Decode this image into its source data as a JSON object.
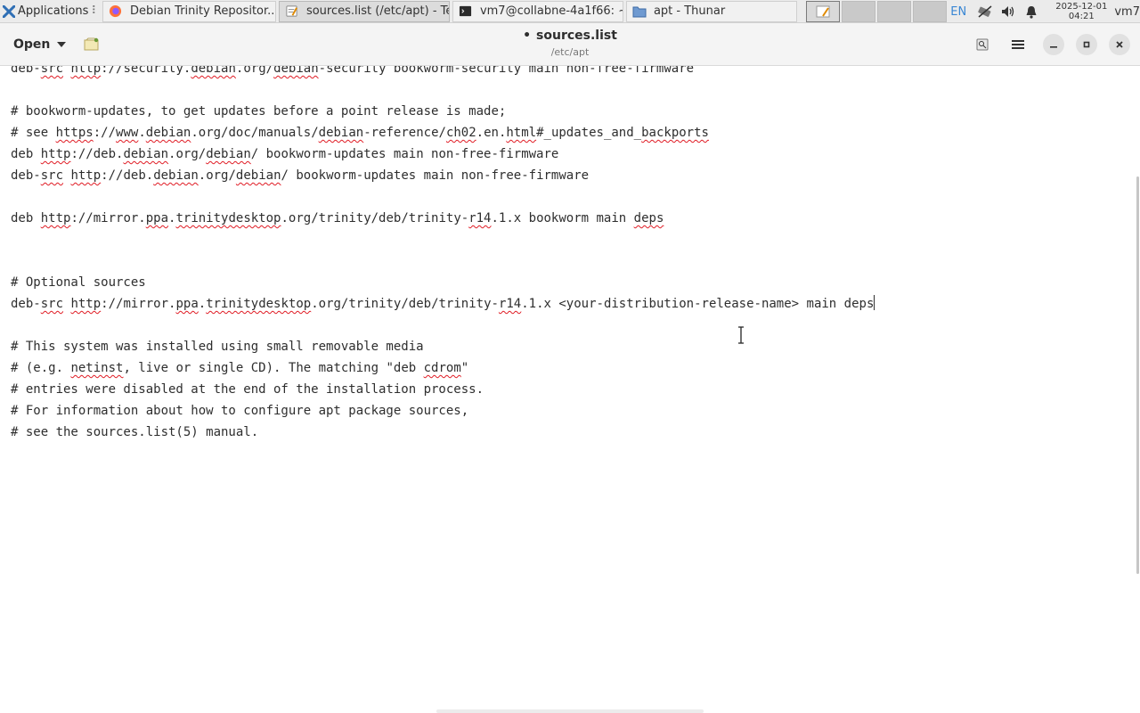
{
  "panel": {
    "applications_label": "Applications",
    "tasks": [
      {
        "label": "Debian Trinity Repositor...",
        "icon": "firefox-icon"
      },
      {
        "label": "sources.list (/etc/apt) - Te...",
        "icon": "text-editor-icon"
      },
      {
        "label": "vm7@collabne-4a1f66: ~",
        "icon": "terminal-icon"
      },
      {
        "label": "apt - Thunar",
        "icon": "folder-icon"
      }
    ],
    "keyboard_layout": "EN",
    "date": "2025-12-01",
    "time": "04:21",
    "user": "vm7"
  },
  "header": {
    "open_label": "Open",
    "title": "sources.list",
    "modified_marker": "•",
    "subtitle": "/etc/apt"
  },
  "editor": {
    "lines": [
      [
        {
          "t": "deb-"
        },
        {
          "t": "src",
          "s": 1
        },
        {
          "t": " "
        },
        {
          "t": "http",
          "s": 1
        },
        {
          "t": "://security."
        },
        {
          "t": "debian",
          "s": 1
        },
        {
          "t": ".org/"
        },
        {
          "t": "debian",
          "s": 1
        },
        {
          "t": "-security bookworm-security main non-free-firmware"
        }
      ],
      [],
      [
        {
          "t": "# bookworm-updates, to get updates before a point release is made;"
        }
      ],
      [
        {
          "t": "# see "
        },
        {
          "t": "https",
          "s": 1
        },
        {
          "t": "://"
        },
        {
          "t": "www",
          "s": 1
        },
        {
          "t": "."
        },
        {
          "t": "debian",
          "s": 1
        },
        {
          "t": ".org/doc/manuals/"
        },
        {
          "t": "debian",
          "s": 1
        },
        {
          "t": "-reference/"
        },
        {
          "t": "ch02",
          "s": 1
        },
        {
          "t": ".en."
        },
        {
          "t": "html",
          "s": 1
        },
        {
          "t": "#_updates_and_"
        },
        {
          "t": "backports",
          "s": 1
        }
      ],
      [
        {
          "t": "deb "
        },
        {
          "t": "http",
          "s": 1
        },
        {
          "t": "://deb."
        },
        {
          "t": "debian",
          "s": 1
        },
        {
          "t": ".org/"
        },
        {
          "t": "debian",
          "s": 1
        },
        {
          "t": "/ bookworm-updates main non-free-firmware"
        }
      ],
      [
        {
          "t": "deb-"
        },
        {
          "t": "src",
          "s": 1
        },
        {
          "t": " "
        },
        {
          "t": "http",
          "s": 1
        },
        {
          "t": "://deb."
        },
        {
          "t": "debian",
          "s": 1
        },
        {
          "t": ".org/"
        },
        {
          "t": "debian",
          "s": 1
        },
        {
          "t": "/ bookworm-updates main non-free-firmware"
        }
      ],
      [],
      [
        {
          "t": "deb "
        },
        {
          "t": "http",
          "s": 1
        },
        {
          "t": "://mirror."
        },
        {
          "t": "ppa",
          "s": 1
        },
        {
          "t": "."
        },
        {
          "t": "trinitydesktop",
          "s": 1
        },
        {
          "t": ".org/trinity/deb/trinity-"
        },
        {
          "t": "r14",
          "s": 1
        },
        {
          "t": ".1.x bookworm main "
        },
        {
          "t": "deps",
          "s": 1
        }
      ],
      [],
      [],
      [
        {
          "t": "# Optional sources"
        }
      ],
      [
        {
          "t": "deb-"
        },
        {
          "t": "src",
          "s": 1
        },
        {
          "t": " "
        },
        {
          "t": "http",
          "s": 1
        },
        {
          "t": "://mirror."
        },
        {
          "t": "ppa",
          "s": 1
        },
        {
          "t": "."
        },
        {
          "t": "trinitydesktop",
          "s": 1
        },
        {
          "t": ".org/trinity/deb/trinity-"
        },
        {
          "t": "r14",
          "s": 1
        },
        {
          "t": ".1.x <your-distribution-release-name> main deps"
        },
        {
          "cursor": 1
        }
      ],
      [],
      [
        {
          "t": "# This system was installed using small removable media"
        }
      ],
      [
        {
          "t": "# (e.g. "
        },
        {
          "t": "netinst",
          "s": 1
        },
        {
          "t": ", live or single CD). The matching \"deb "
        },
        {
          "t": "cdrom",
          "s": 1
        },
        {
          "t": "\""
        }
      ],
      [
        {
          "t": "# entries were disabled at the end of the installation process."
        }
      ],
      [
        {
          "t": "# For information about how to configure apt package sources,"
        }
      ],
      [
        {
          "t": "# see the sources.list(5) manual."
        }
      ]
    ]
  }
}
